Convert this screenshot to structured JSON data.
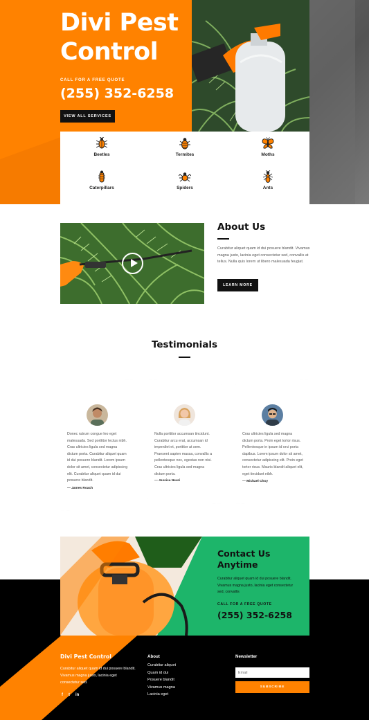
{
  "colors": {
    "accent_orange": "#ff8200",
    "contact_green": "#1db56a",
    "dark": "#111111"
  },
  "hero": {
    "title": "Divi Pest Control",
    "subtitle": "CALL FOR A FREE QUOTE",
    "phone": "(255) 352-6258",
    "button_label": "VIEW ALL SERVICES"
  },
  "pests": [
    {
      "label": "Beetles",
      "icon": "beetle-icon"
    },
    {
      "label": "Termites",
      "icon": "termite-icon"
    },
    {
      "label": "Moths",
      "icon": "moth-icon"
    },
    {
      "label": "Caterpillars",
      "icon": "caterpillar-icon"
    },
    {
      "label": "Spiders",
      "icon": "spider-icon"
    },
    {
      "label": "Ants",
      "icon": "ant-icon"
    }
  ],
  "about": {
    "title": "About Us",
    "text": "Curabitur aliquet quam id dui posuere blandit. Vivamus magna justo, lacinia eget consectetur sed, convallis at tellus. Nulla quis lorem ut libero malesuada feugiat.",
    "button_label": "LEARN MORE",
    "video_icon": "play-icon"
  },
  "testimonials": {
    "title": "Testimonials",
    "items": [
      {
        "quote": "Donec rutrum congue leo eget malesuada. Sed porttitor lectus nibh. Cras ultricies ligula sed magna dictum porta. Curabitur aliquet quam id dui posuere blandit. Lorem ipsum dolor sit amet, consectetur adipiscing elit. Curabitur aliquet quam id dui posuere blandit.",
        "author": "— James Roach"
      },
      {
        "quote": "Nulla porttitor accumsan tincidunt. Curabitur arcu erat, accumsan id imperdiet et, porttitor at sem. Praesent sapien massa, convallis a pellentesque nec, egestas non nisi. Cras ultricies ligula sed magna dictum porta.",
        "author": "— Jessica Neuri"
      },
      {
        "quote": "Cras ultricies ligula sed magna dictum porta. Proin eget tortor risus. Pellentesque in ipsum id orci porta dapibus. Lorem ipsum dolor sit amet, consectetur adipiscing elit. Proin eget tortor risus. Mauris blandit aliquet elit, eget tincidunt nibh.",
        "author": "— Michael Choy"
      }
    ]
  },
  "contact": {
    "title": "Contact Us Anytime",
    "text": "Curabitur aliquet quam id dui posuere blandit. Vivamus magna justo, lacinia eget consectetur sed, convallis",
    "subtitle": "CALL FOR A FREE QUOTE",
    "phone": "(255) 352-6258"
  },
  "footer": {
    "brand": "Divi Pest Control",
    "brand_text": "Curabitur aliquet quam id dui posuere blandit. Vivamus magna justo, lacinia eget consectetur sed.",
    "social": [
      "f",
      "t",
      "in"
    ],
    "about_title": "About",
    "about_links": [
      "Curabitur aliquet",
      "Quam id dui",
      "Posuere blandit",
      "Vivamus magna",
      "Lacinia eget"
    ],
    "newsletter_title": "Newsletter",
    "email_placeholder": "Email",
    "subscribe_label": "SUBSCRIBE"
  }
}
